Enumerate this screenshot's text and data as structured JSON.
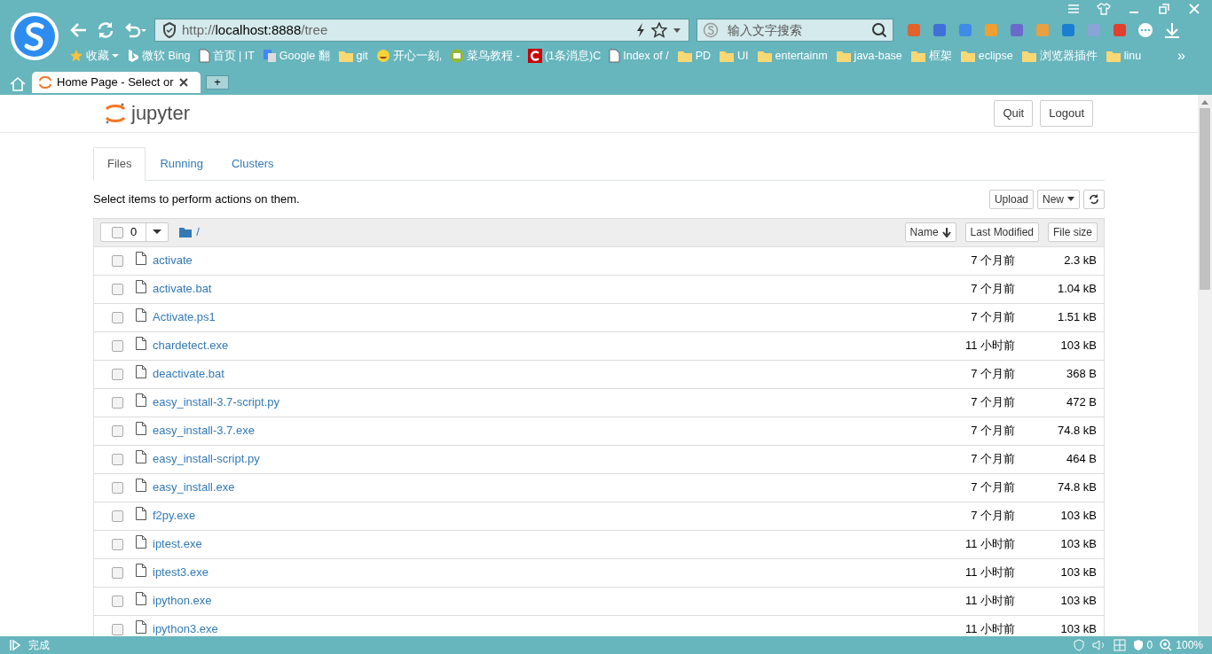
{
  "browser": {
    "address": {
      "scheme": "http://",
      "host": "localhost:8888",
      "path": "/tree"
    },
    "search": {
      "placeholder": "输入文字搜索"
    },
    "bookmarks": [
      {
        "label": "收藏",
        "kind": "star"
      },
      {
        "label": "微软 Bing",
        "kind": "bing"
      },
      {
        "label": "首页 | IT",
        "kind": "page"
      },
      {
        "label": "Google 翻",
        "kind": "google"
      },
      {
        "label": "git",
        "kind": "folder"
      },
      {
        "label": "开心一刻,",
        "kind": "emoji"
      },
      {
        "label": "菜鸟教程 -",
        "kind": "runoob"
      },
      {
        "label": "(1条消息)C",
        "kind": "csdn"
      },
      {
        "label": "Index of /",
        "kind": "page"
      },
      {
        "label": "PD",
        "kind": "folder"
      },
      {
        "label": "UI",
        "kind": "folder"
      },
      {
        "label": "entertainm",
        "kind": "folder"
      },
      {
        "label": "java-base",
        "kind": "folder"
      },
      {
        "label": "框架",
        "kind": "folder"
      },
      {
        "label": "eclipse",
        "kind": "folder"
      },
      {
        "label": "浏览器插件",
        "kind": "folder"
      },
      {
        "label": "linu",
        "kind": "folder"
      }
    ],
    "bookmarks_more": "»",
    "tabs": [
      {
        "label": "Home Page - Select or",
        "selected": true
      }
    ],
    "new_tab": "+",
    "status": {
      "text": "完成",
      "count": "0",
      "zoom": "100%"
    }
  },
  "jupyter": {
    "logo": "jupyter",
    "header_buttons": [
      "Quit",
      "Logout"
    ],
    "tabs": [
      {
        "label": "Files",
        "selected": true
      },
      {
        "label": "Running",
        "selected": false
      },
      {
        "label": "Clusters",
        "selected": false
      }
    ],
    "hint": "Select items to perform actions on them.",
    "actions": [
      "Upload",
      "New"
    ],
    "select_all_checked": false,
    "selected_count": "0",
    "path": "/",
    "columns": [
      "Name",
      "Last Modified",
      "File size"
    ],
    "files": [
      {
        "name": "activate",
        "modified": "7 个月前",
        "size": "2.3 kB",
        "checked": false
      },
      {
        "name": "activate.bat",
        "modified": "7 个月前",
        "size": "1.04 kB",
        "checked": false
      },
      {
        "name": "Activate.ps1",
        "modified": "7 个月前",
        "size": "1.51 kB",
        "checked": false
      },
      {
        "name": "chardetect.exe",
        "modified": "11 小时前",
        "size": "103 kB",
        "checked": false
      },
      {
        "name": "deactivate.bat",
        "modified": "7 个月前",
        "size": "368 B",
        "checked": false
      },
      {
        "name": "easy_install-3.7-script.py",
        "modified": "7 个月前",
        "size": "472 B",
        "checked": false
      },
      {
        "name": "easy_install-3.7.exe",
        "modified": "7 个月前",
        "size": "74.8 kB",
        "checked": false
      },
      {
        "name": "easy_install-script.py",
        "modified": "7 个月前",
        "size": "464 B",
        "checked": false
      },
      {
        "name": "easy_install.exe",
        "modified": "7 个月前",
        "size": "74.8 kB",
        "checked": false
      },
      {
        "name": "f2py.exe",
        "modified": "7 个月前",
        "size": "103 kB",
        "checked": false
      },
      {
        "name": "iptest.exe",
        "modified": "11 小时前",
        "size": "103 kB",
        "checked": false
      },
      {
        "name": "iptest3.exe",
        "modified": "11 小时前",
        "size": "103 kB",
        "checked": false
      },
      {
        "name": "ipython.exe",
        "modified": "11 小时前",
        "size": "103 kB",
        "checked": false
      },
      {
        "name": "ipython3.exe",
        "modified": "11 小时前",
        "size": "103 kB",
        "checked": false
      }
    ]
  }
}
